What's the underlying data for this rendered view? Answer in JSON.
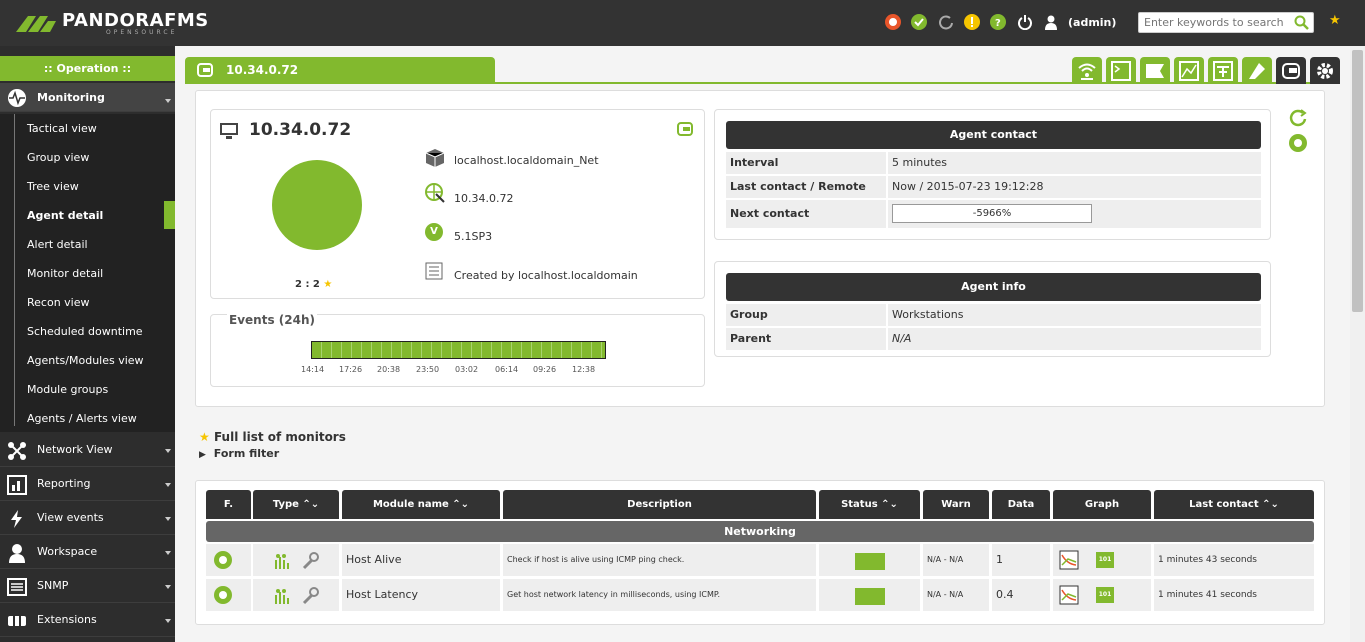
{
  "header": {
    "logo_text": "PANDORAFMS",
    "logo_sub": "OPENSOURCE",
    "user_label": "(admin)",
    "search_placeholder": "Enter keywords to search"
  },
  "sidebar": {
    "section_title": ":: Operation ::",
    "monitoring_label": "Monitoring",
    "submenu": [
      "Tactical view",
      "Group view",
      "Tree view",
      "Agent detail",
      "Alert detail",
      "Monitor detail",
      "Recon view",
      "Scheduled downtime",
      "Agents/Modules view",
      "Module groups",
      "Agents / Alerts view"
    ],
    "selected_index": 3,
    "menus": [
      "Network View",
      "Reporting",
      "View events",
      "Workspace",
      "SNMP",
      "Extensions"
    ]
  },
  "tab": {
    "title": "10.34.0.72"
  },
  "agent": {
    "title": "10.34.0.72",
    "count_label": "2 : 2",
    "info": [
      "localhost.localdomain_Net",
      "10.34.0.72",
      "5.1SP3",
      "Created by localhost.localdomain"
    ],
    "version_icon_letter": "V"
  },
  "events": {
    "title": "Events (24h)",
    "ticks": [
      "14:14",
      "17:26",
      "20:38",
      "23:50",
      "03:02",
      "06:14",
      "09:26",
      "12:38"
    ]
  },
  "contact": {
    "title": "Agent contact",
    "rows": [
      {
        "k": "Interval",
        "v": "5 minutes"
      },
      {
        "k": "Last contact / Remote",
        "v": "Now / 2015-07-23 19:12:28"
      },
      {
        "k": "Next contact",
        "v": "-5966%"
      }
    ]
  },
  "agent_info": {
    "title": "Agent info",
    "rows": [
      {
        "k": "Group",
        "v": "Workstations"
      },
      {
        "k": "Parent",
        "v": "N/A"
      }
    ]
  },
  "monitors": {
    "full_list_label": "Full list of monitors",
    "form_filter_label": "Form filter",
    "columns": [
      "F.",
      "Type",
      "Module name",
      "Description",
      "Status",
      "Warn",
      "Data",
      "Graph",
      "Last contact"
    ],
    "group": "Networking",
    "rows": [
      {
        "name": "Host Alive",
        "description": "Check if host is alive using ICMP ping check.",
        "warn": "N/A - N/A",
        "data": "1",
        "last_contact": "1 minutes 43 seconds"
      },
      {
        "name": "Host Latency",
        "description": "Get host network latency in milliseconds, using ICMP.",
        "warn": "N/A - N/A",
        "data": "0.4",
        "last_contact": "1 minutes 41 seconds"
      }
    ],
    "graph_badge": "101"
  },
  "colors": {
    "accent": "#82b92e",
    "dark": "#333333",
    "background": "#f4f4f4"
  }
}
